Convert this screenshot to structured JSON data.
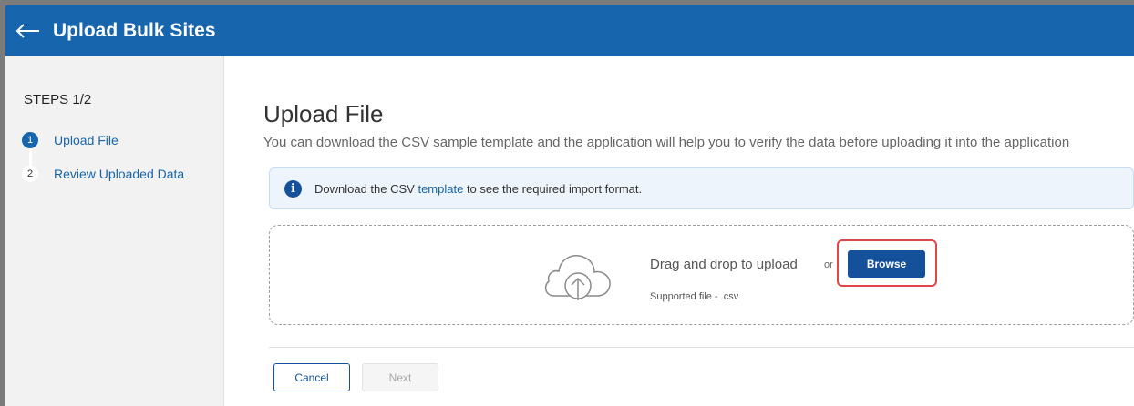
{
  "header": {
    "title": "Upload Bulk Sites",
    "back_icon": "arrow-left-icon"
  },
  "sidebar": {
    "steps_title": "STEPS 1/2",
    "steps": [
      {
        "number": "1",
        "label": "Upload File",
        "active": true
      },
      {
        "number": "2",
        "label": "Review Uploaded Data",
        "active": false
      }
    ]
  },
  "main": {
    "title": "Upload File",
    "description": "You can download the CSV sample template and the application will help you to verify the data before uploading it into the application",
    "info": {
      "icon": "info-icon",
      "prefix": "Download the CSV ",
      "link": "template",
      "suffix": " to see the required import format."
    },
    "dropzone": {
      "icon": "cloud-upload-icon",
      "text": "Drag and drop to upload",
      "or": "or",
      "browse_label": "Browse",
      "supported": "Supported file - .csv"
    },
    "buttons": {
      "cancel": "Cancel",
      "next": "Next"
    }
  },
  "colors": {
    "header_bg": "#1765ad",
    "primary": "#15519a",
    "highlight": "#e04848",
    "info_bg": "#edf4fc"
  }
}
